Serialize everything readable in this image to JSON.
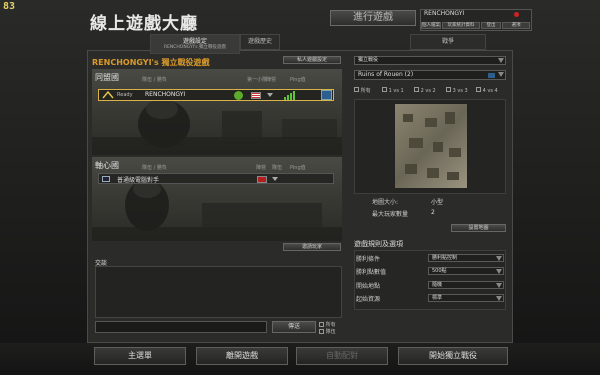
{
  "fps": "83",
  "title": "線上遊戲大廳",
  "top_button": "進行遊戲",
  "user": {
    "name": "RENCHONGYI",
    "buttons": [
      "個人檔案",
      "玩家統計資料",
      "登出",
      "選項"
    ]
  },
  "tabs": {
    "settings": "遊戲設定",
    "settings_sub": "RENCHONGYI's 獨立戰役遊戲",
    "history": "遊戲歷史",
    "chat": "戰爭"
  },
  "game": {
    "title": "RENCHONGYI's 獨立戰役遊戲",
    "private_btn": "私人遊戲設定"
  },
  "allies": {
    "label": "同盟國",
    "col_team": "隊伍 / 勝負",
    "col_rank": "第一小隊",
    "col_type": "陣營",
    "col_ping": "Ping值",
    "slot_text": "Ready",
    "player": "RENCHONGYI"
  },
  "axis": {
    "label": "軸心國",
    "col_team": "隊伍 / 勝負",
    "col_type": "陣營",
    "col_rank": "隊伍",
    "col_ping": "Ping值",
    "player": "普通級電腦對手"
  },
  "invite_btn": "邀請玩家",
  "chat": {
    "label": "交談",
    "send": "傳送",
    "opt1": "所有",
    "opt2": "隊伍"
  },
  "right": {
    "mode": "獨立戰役",
    "map": "Ruins of Rouen (2)",
    "players": [
      "所有",
      "1 vs 1",
      "2 vs 2",
      "3 vs 3",
      "4 vs 4"
    ],
    "map_size_label": "地圖大小:",
    "map_size_value": "小型",
    "max_players_label": "最大玩家數量",
    "max_players_value": "2",
    "map_btn": "設置地圖",
    "rules_title": "遊戲規則及選項",
    "rules": [
      {
        "label": "勝利條件",
        "value": "勝利點控制"
      },
      {
        "label": "勝利點數值",
        "value": "500點"
      },
      {
        "label": "開始地點",
        "value": "隨機"
      },
      {
        "label": "起始資源",
        "value": "標準"
      }
    ]
  },
  "bottom": {
    "main_menu": "主選單",
    "leave": "離開遊戲",
    "auto_match": "自動配對",
    "start": "開始獨立戰役"
  },
  "colors": {
    "accent": "#d99a2a",
    "ping_good": "#5ec43a",
    "faction_red": "#c22222"
  }
}
